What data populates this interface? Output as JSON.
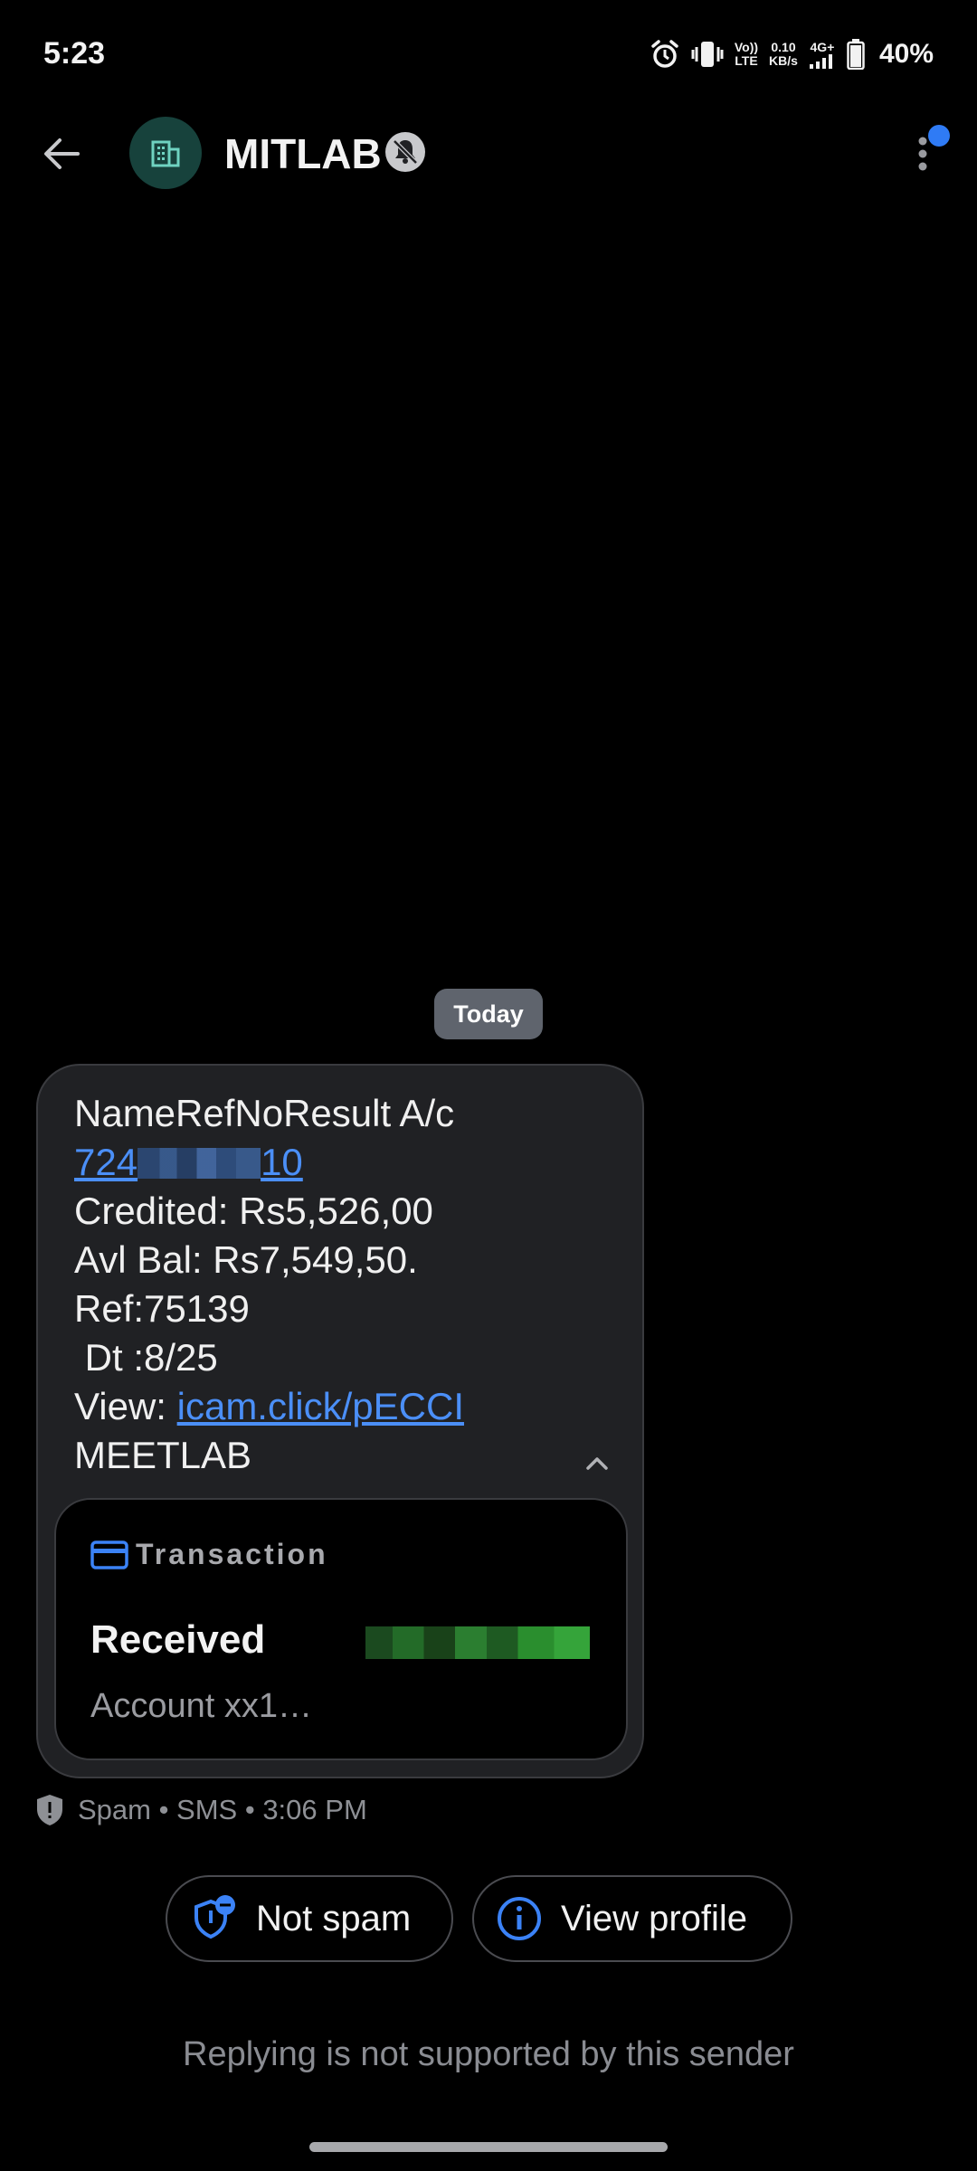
{
  "status_bar": {
    "time": "5:23",
    "volte_top": "Vo))",
    "volte_bottom": "LTE",
    "speed_top": "0.10",
    "speed_bottom": "KB/s",
    "network": "4G+",
    "battery": "40%",
    "icons": [
      "alarm-icon",
      "vibrate-icon",
      "signal-icon",
      "battery-icon"
    ]
  },
  "header": {
    "title": "MITLAB",
    "avatar_icon": "building-icon",
    "colors": {
      "avatar_bg": "#17423c",
      "avatar_icon": "#6fd3c1",
      "notification_dot": "#2f7bf5"
    }
  },
  "thread": {
    "date_chip": "Today",
    "message": {
      "line1": "NameRefNoResult A/c",
      "acct_prefix": "724",
      "acct_suffix": "10",
      "credited": "Credited: Rs5,526,00",
      "avl_bal": "Avl Bal: Rs7,549,50.",
      "ref": "Ref:75139",
      "dt": " Dt :8/25",
      "view_prefix": "View: ",
      "view_link": "icam.click/pECCI",
      "sender_sign": "MEETLAB"
    },
    "card": {
      "heading": "Transaction",
      "title": "Received",
      "subtitle": "Account xx1…"
    },
    "meta": "Spam • SMS • 3:06 PM"
  },
  "actions": {
    "not_spam": "Not spam",
    "view_profile": "View profile"
  },
  "footer": {
    "note": "Replying is not supported by this sender"
  },
  "colors": {
    "link": "#4b8ff7",
    "bubble_bg": "#202124",
    "accent_blue": "#2f7bf5"
  }
}
